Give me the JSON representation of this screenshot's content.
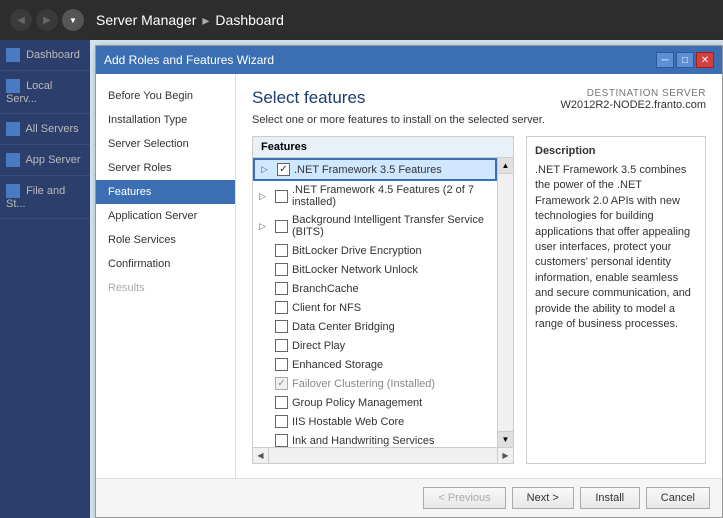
{
  "titleBar": {
    "appName": "Server Manager",
    "separator": "▸",
    "pageName": "Dashboard"
  },
  "sidebar": {
    "items": [
      {
        "id": "dashboard",
        "label": "Dashboard"
      },
      {
        "id": "local-server",
        "label": "Local Serv..."
      },
      {
        "id": "all-servers",
        "label": "All Servers"
      },
      {
        "id": "app-server",
        "label": "App Server"
      },
      {
        "id": "file-storage",
        "label": "File and St..."
      }
    ]
  },
  "dialog": {
    "title": "Add Roles and Features Wizard",
    "destinationLabel": "DESTINATION SERVER",
    "destinationServer": "W2012R2-NODE2.franto.com",
    "header": "Select features",
    "description": "Select one or more features to install on the selected server.",
    "featuresColumnHeader": "Features",
    "descriptionColumnHeader": "Description",
    "descriptionText": ".NET Framework 3.5 combines the power of the .NET Framework 2.0 APIs with new technologies for building applications that offer appealing user interfaces, protect your customers' personal identity information, enable seamless and secure communication, and provide the ability to model a range of business processes.",
    "wizardSteps": [
      {
        "id": "before-you-begin",
        "label": "Before You Begin",
        "state": "normal"
      },
      {
        "id": "installation-type",
        "label": "Installation Type",
        "state": "normal"
      },
      {
        "id": "server-selection",
        "label": "Server Selection",
        "state": "normal"
      },
      {
        "id": "server-roles",
        "label": "Server Roles",
        "state": "normal"
      },
      {
        "id": "features",
        "label": "Features",
        "state": "active"
      },
      {
        "id": "application-server",
        "label": "Application Server",
        "state": "normal"
      },
      {
        "id": "role-services",
        "label": "Role Services",
        "state": "normal"
      },
      {
        "id": "confirmation",
        "label": "Confirmation",
        "state": "normal"
      },
      {
        "id": "results",
        "label": "Results",
        "state": "disabled"
      }
    ],
    "features": [
      {
        "id": "net35",
        "label": ".NET Framework 3.5 Features",
        "checked": true,
        "disabled": false,
        "expandable": true,
        "highlighted": true,
        "indent": 0
      },
      {
        "id": "net45",
        "label": ".NET Framework 4.5 Features (2 of 7 installed)",
        "checked": false,
        "disabled": false,
        "expandable": true,
        "highlighted": false,
        "indent": 0
      },
      {
        "id": "bits",
        "label": "Background Intelligent Transfer Service (BITS)",
        "checked": false,
        "disabled": false,
        "expandable": true,
        "highlighted": false,
        "indent": 0
      },
      {
        "id": "bitlocker",
        "label": "BitLocker Drive Encryption",
        "checked": false,
        "disabled": false,
        "expandable": false,
        "highlighted": false,
        "indent": 0
      },
      {
        "id": "bitlocker-unlock",
        "label": "BitLocker Network Unlock",
        "checked": false,
        "disabled": false,
        "expandable": false,
        "highlighted": false,
        "indent": 0
      },
      {
        "id": "branchcache",
        "label": "BranchCache",
        "checked": false,
        "disabled": false,
        "expandable": false,
        "highlighted": false,
        "indent": 0
      },
      {
        "id": "client-nfs",
        "label": "Client for NFS",
        "checked": false,
        "disabled": false,
        "expandable": false,
        "highlighted": false,
        "indent": 0
      },
      {
        "id": "datacenter-bridging",
        "label": "Data Center Bridging",
        "checked": false,
        "disabled": false,
        "expandable": false,
        "highlighted": false,
        "indent": 0
      },
      {
        "id": "direct-play",
        "label": "Direct Play",
        "checked": false,
        "disabled": false,
        "expandable": false,
        "highlighted": false,
        "indent": 0
      },
      {
        "id": "enhanced-storage",
        "label": "Enhanced Storage",
        "checked": false,
        "disabled": false,
        "expandable": false,
        "highlighted": false,
        "indent": 0
      },
      {
        "id": "failover-clustering",
        "label": "Failover Clustering (Installed)",
        "checked": true,
        "disabled": true,
        "expandable": false,
        "highlighted": false,
        "indent": 0
      },
      {
        "id": "group-policy",
        "label": "Group Policy Management",
        "checked": false,
        "disabled": false,
        "expandable": false,
        "highlighted": false,
        "indent": 0
      },
      {
        "id": "iis-hostable",
        "label": "IIS Hostable Web Core",
        "checked": false,
        "disabled": false,
        "expandable": false,
        "highlighted": false,
        "indent": 0
      },
      {
        "id": "ink-handwriting",
        "label": "Ink and Handwriting Services",
        "checked": false,
        "disabled": false,
        "expandable": false,
        "highlighted": false,
        "indent": 0
      }
    ],
    "buttons": {
      "previous": "< Previous",
      "next": "Next >",
      "install": "Install",
      "cancel": "Cancel"
    }
  }
}
